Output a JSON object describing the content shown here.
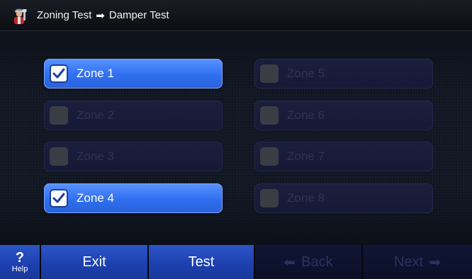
{
  "title": {
    "part1": "Zoning Test",
    "arrow": "➡",
    "part2": "Damper Test",
    "icon": "technician-icon"
  },
  "zones": [
    {
      "label": "Zone 1",
      "checked": true
    },
    {
      "label": "Zone 2",
      "checked": false
    },
    {
      "label": "Zone 3",
      "checked": false
    },
    {
      "label": "Zone 4",
      "checked": true
    },
    {
      "label": "Zone 5",
      "checked": false
    },
    {
      "label": "Zone 6",
      "checked": false
    },
    {
      "label": "Zone 7",
      "checked": false
    },
    {
      "label": "Zone 8",
      "checked": false
    }
  ],
  "bottombar": {
    "help_symbol": "?",
    "help_label": "Help",
    "exit_label": "Exit",
    "test_label": "Test",
    "back_arrow": "⬅",
    "back_label": "Back",
    "next_label": "Next",
    "next_arrow": "➡"
  },
  "colors": {
    "zone_active": "#2f6ff0",
    "zone_inactive": "#1b1f3e",
    "button_active": "#2c55c8",
    "button_inactive": "#101534"
  }
}
